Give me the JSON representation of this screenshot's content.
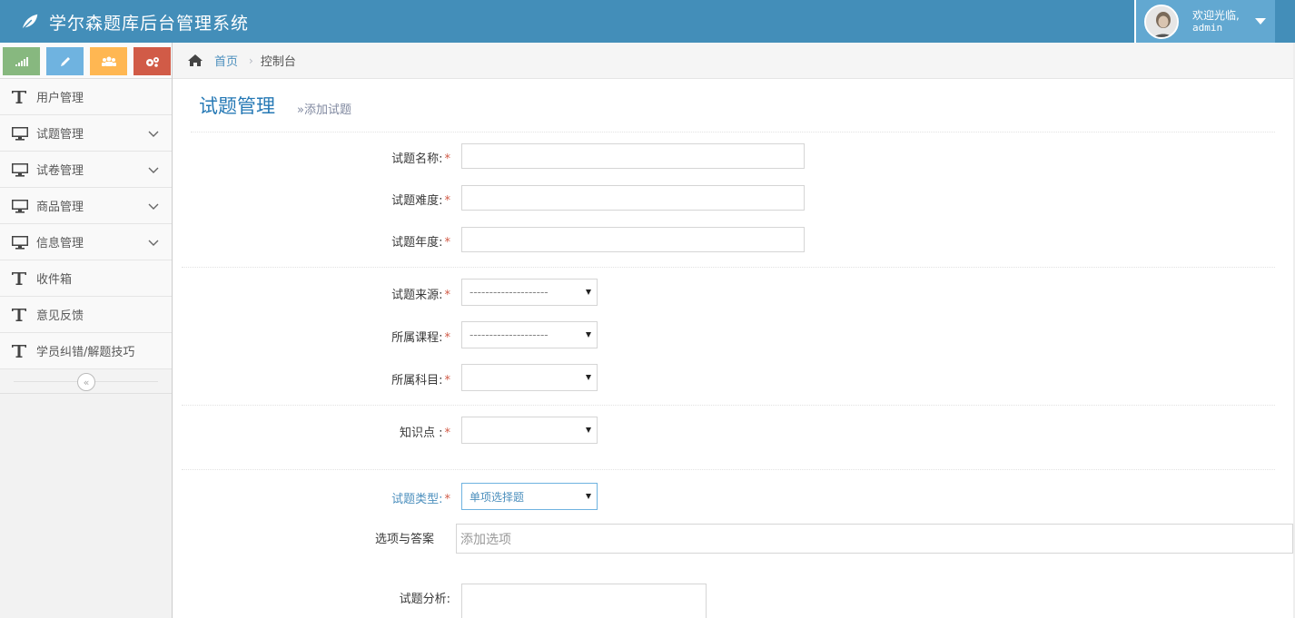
{
  "app": {
    "title": "学尔森题库后台管理系统"
  },
  "user": {
    "welcome": "欢迎光临,",
    "name": "admin"
  },
  "sidebar": {
    "shortcuts": [
      "stats-icon",
      "pencil-icon",
      "group-icon",
      "cogs-icon"
    ],
    "items": [
      {
        "label": "用户管理",
        "icon": "text-icon",
        "has_arrow": false
      },
      {
        "label": "试题管理",
        "icon": "desktop-icon",
        "has_arrow": true
      },
      {
        "label": "试卷管理",
        "icon": "desktop-icon",
        "has_arrow": true
      },
      {
        "label": "商品管理",
        "icon": "desktop-icon",
        "has_arrow": true
      },
      {
        "label": "信息管理",
        "icon": "desktop-icon",
        "has_arrow": true
      },
      {
        "label": "收件箱",
        "icon": "text-icon",
        "has_arrow": false
      },
      {
        "label": "意见反馈",
        "icon": "text-icon",
        "has_arrow": false
      },
      {
        "label": "学员纠错/解题技巧",
        "icon": "text-icon",
        "has_arrow": false
      }
    ],
    "collapse_glyph": "«"
  },
  "breadcrumbs": {
    "home": "首页",
    "current": "控制台"
  },
  "page": {
    "title": "试题管理",
    "subtitle": "»添加试题"
  },
  "form": {
    "name_label": "试题名称:",
    "difficulty_label": "试题难度:",
    "year_label": "试题年度:",
    "source_label": "试题来源:",
    "source_value": "--------------------",
    "course_label": "所属课程:",
    "course_value": "--------------------",
    "subject_label": "所属科目:",
    "subject_value": "",
    "knowledge_label": "知识点 :",
    "knowledge_value": "",
    "type_label": "试题类型:",
    "type_value": "单项选择题",
    "options_label": "选项与答案",
    "options_placeholder": "添加选项",
    "analysis_label": "试题分析:",
    "required_mark": "*"
  },
  "colors": {
    "navbar": "#438eb9",
    "accent": "#2679b5",
    "required": "#d15b47"
  }
}
